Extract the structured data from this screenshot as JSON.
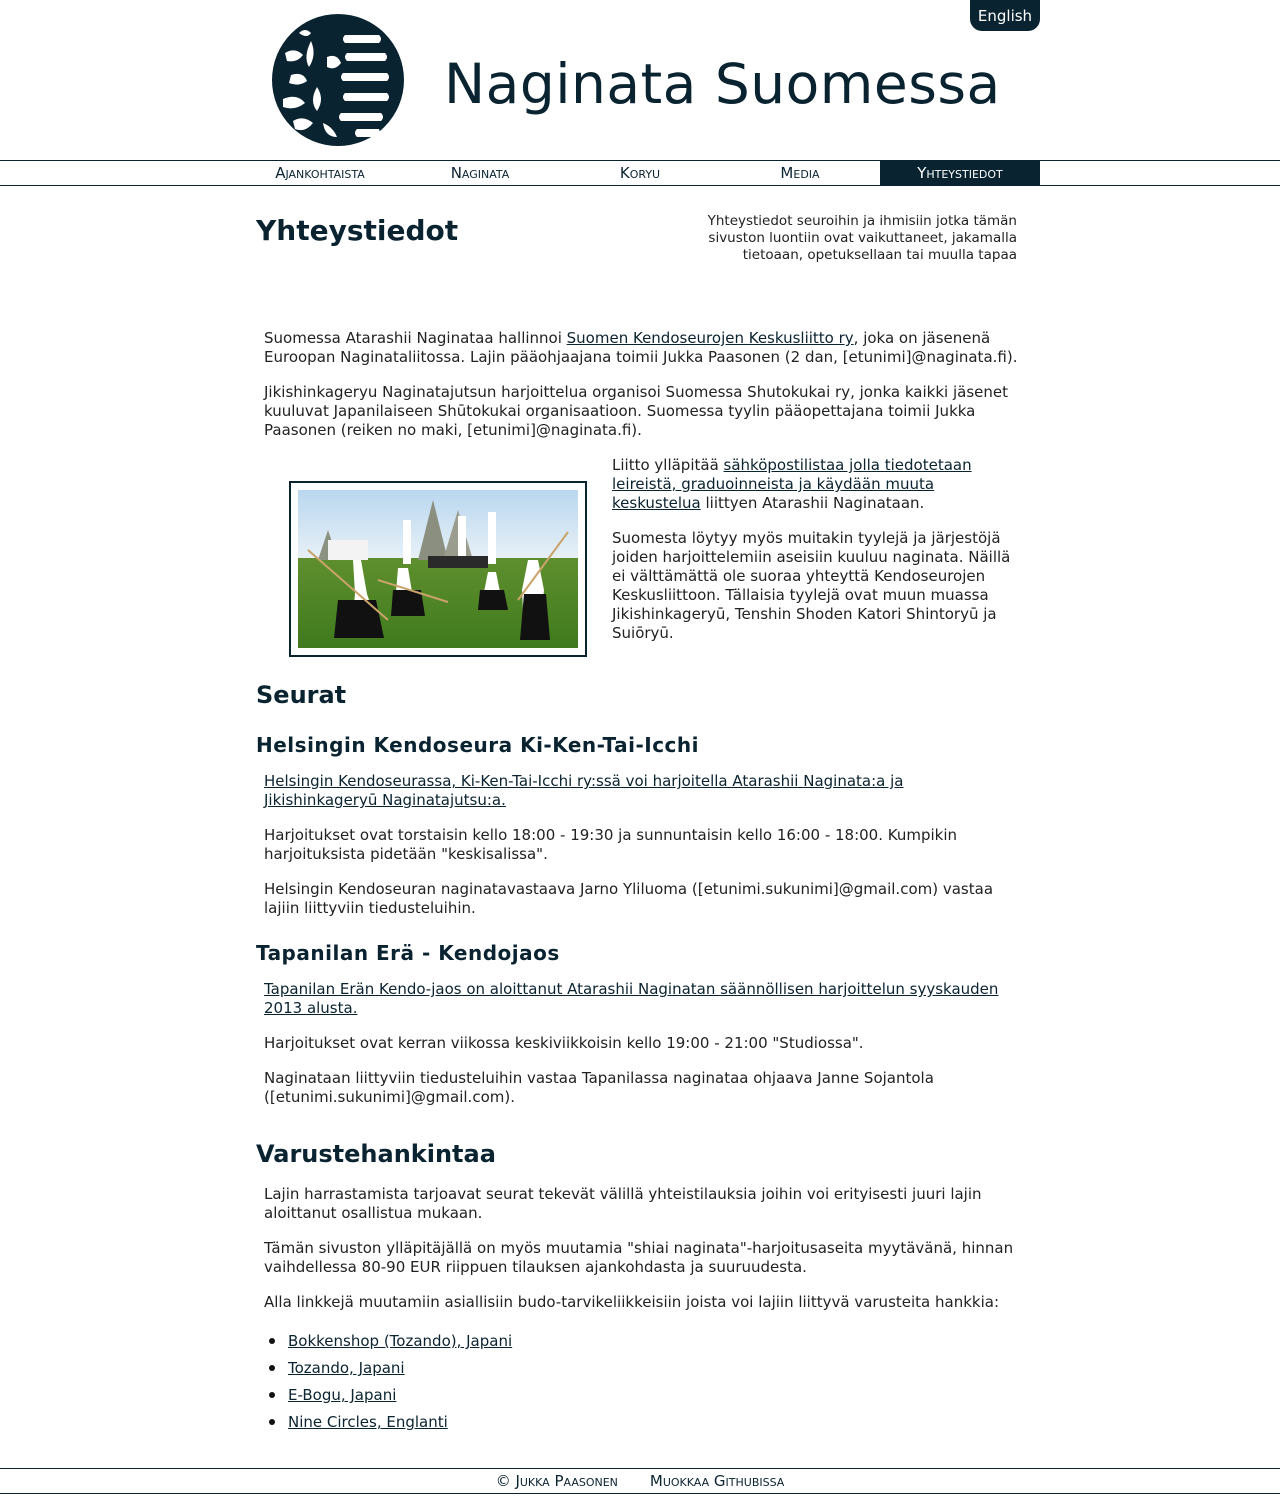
{
  "header": {
    "language_button": "English",
    "site_title": "Naginata Suomessa",
    "logo_icon": "naginata-suomessa-logo-icon"
  },
  "nav": {
    "items": [
      {
        "label": "Ajankohtaista"
      },
      {
        "label": "Naginata"
      },
      {
        "label": "Koryu"
      },
      {
        "label": "Media"
      },
      {
        "label": "Yhteystiedot"
      }
    ],
    "active_index": 4
  },
  "page": {
    "title": "Yhteystiedot",
    "description": "Yhteystiedot seuroihin ja ihmisiin jotka tämän sivuston luontiin ovat vaikuttaneet, jakamalla tietoaan, opetuksellaan tai muulla tapaa"
  },
  "intro": {
    "p1_before": "Suomessa Atarashii Naginataa hallinnoi ",
    "p1_link": "Suomen Kendoseurojen Keskusliitto ry",
    "p1_after": ", joka on jäsenenä Euroopan Naginataliitossa. Lajin pääohjaajana toimii Jukka Paasonen (2 dan, [etunimi]@naginata.fi).",
    "p2": "Jikishinkageryu Naginatajutsun harjoittelua organisoi Suomessa Shutokukai ry, jonka kaikki jäsenet kuuluvat Japanilaiseen Shūtokukai organisaatioon. Suomessa tyylin pääopettajana toimii Jukka Paasonen (reiken no maki, [etunimi]@naginata.fi).",
    "p3_before": "Liitto ylläpitää ",
    "p3_link": "sähköpostilistaa jolla tiedotetaan leireistä, graduoinneista ja käydään muuta keskustelua",
    "p3_after": " liittyen Atarashii Naginataan.",
    "p4": "Suomesta löytyy myös muitakin tyylejä ja järjestöjä joiden harjoittelemiin aseisiin kuuluu naginata. Näillä ei välttämättä ole suoraa yhteyttä Kendoseurojen Keskusliittoon. Tällaisia tyylejä ovat muun muassa Jikishinkageryū, Tenshin Shoden Katori Shintoryū ja Suiōryū.",
    "photo_icon": "naginata-practice-photo-icon"
  },
  "seurat": {
    "title": "Seurat",
    "clubs": [
      {
        "name": "Helsingin Kendoseura Ki-Ken-Tai-Icchi",
        "link": "Helsingin Kendoseurassa, Ki-Ken-Tai-Icchi ry:ssä voi harjoitella Atarashii Naginata:a ja Jikishinkageryū Naginatajutsu:a.",
        "p2": "Harjoitukset ovat torstaisin kello 18:00 - 19:30 ja sunnuntaisin kello 16:00 - 18:00. Kumpikin harjoituksista pidetään \"keskisalissa\".",
        "p3": "Helsingin Kendoseuran naginatavastaava Jarno Yliluoma ([etunimi.sukunimi]@gmail.com) vastaa lajiin liittyviin tiedusteluihin."
      },
      {
        "name": "Tapanilan Erä - Kendojaos",
        "link": "Tapanilan Erän Kendo-jaos on aloittanut Atarashii Naginatan säännöllisen harjoittelun syyskauden 2013 alusta.",
        "p2": "Harjoitukset ovat kerran viikossa keskiviikkoisin kello 19:00 - 21:00 \"Studiossa\".",
        "p3": "Naginataan liittyviin tiedusteluihin vastaa Tapanilassa naginataa ohjaava Janne Sojantola ([etunimi.sukunimi]@gmail.com)."
      }
    ]
  },
  "varusteet": {
    "title": "Varustehankintaa",
    "p1": "Lajin harrastamista tarjoavat seurat tekevät välillä yhteistilauksia joihin voi erityisesti juuri lajin aloittanut osallistua mukaan.",
    "p2": "Tämän sivuston ylläpitäjällä on myös muutamia \"shiai naginata\"-harjoitusaseita myytävänä, hinnan vaihdellessa 80-90 EUR riippuen tilauksen ajankohdasta ja suuruudesta.",
    "p3": "Alla linkkejä muutamiin asiallisiin budo-tarvikeliikkeisiin joista voi lajiin liittyvä varusteita hankkia:",
    "shops": [
      {
        "label": "Bokkenshop (Tozando), Japani"
      },
      {
        "label": "Tozando, Japani"
      },
      {
        "label": "E-Bogu, Japani"
      },
      {
        "label": "Nine Circles, Englanti"
      }
    ]
  },
  "footer": {
    "copyright": "© Jukka Paasonen",
    "edit_link": "Muokkaa Githubissa"
  },
  "colors": {
    "accent": "#0a2330",
    "text": "#222222",
    "background": "#ffffff"
  }
}
